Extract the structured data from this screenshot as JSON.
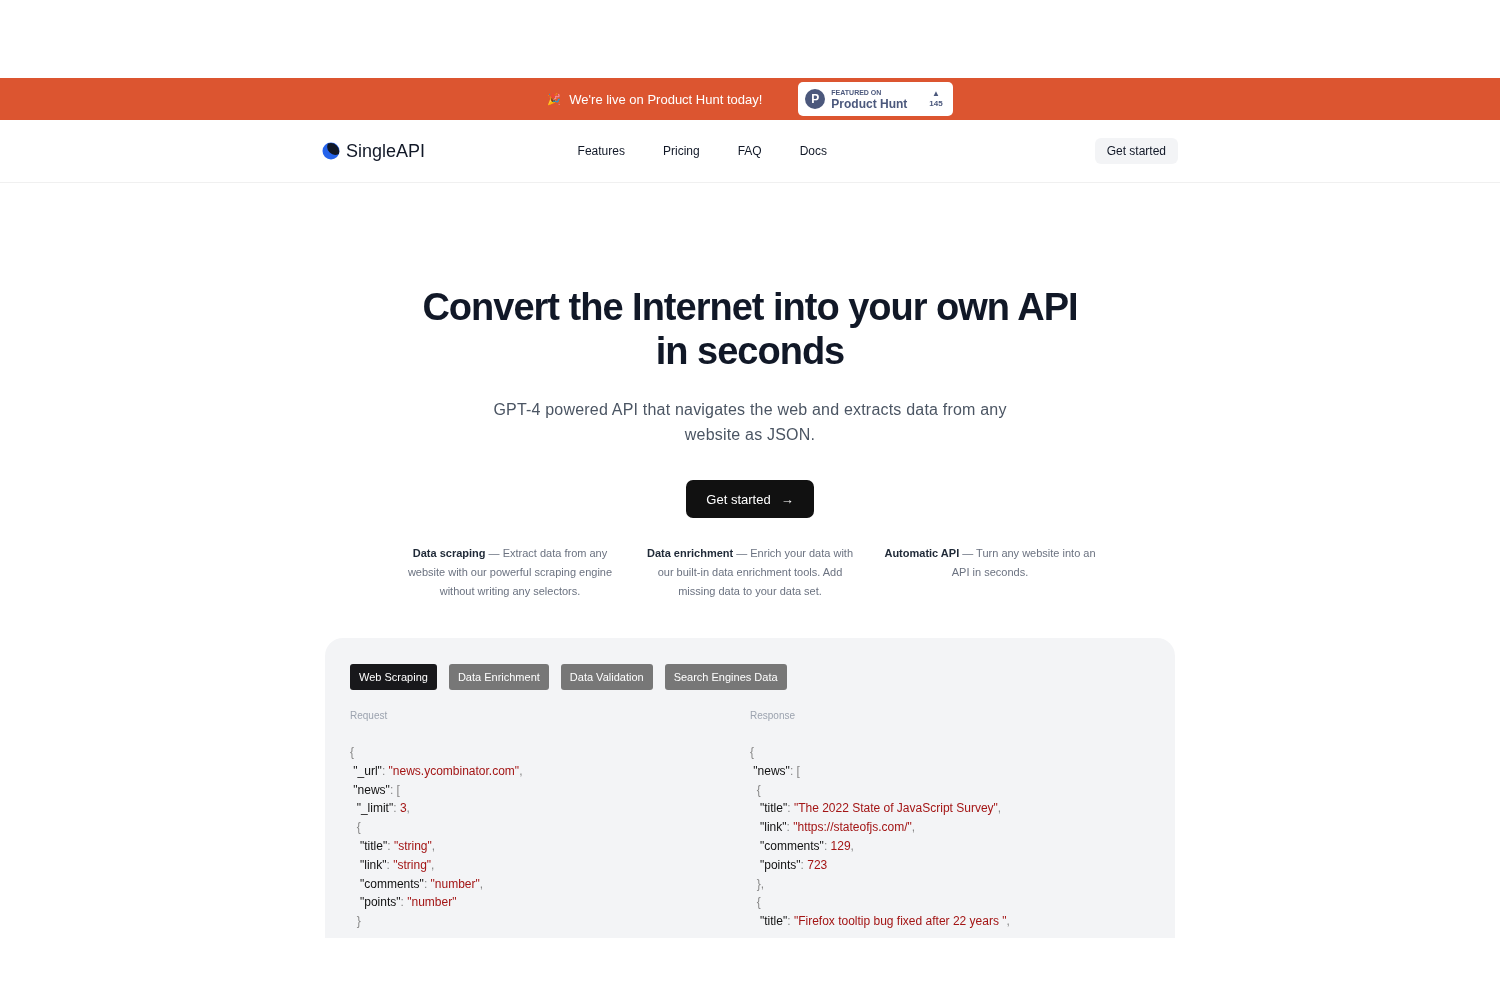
{
  "banner": {
    "emoji": "🎉",
    "text": "We're live on Product Hunt today!",
    "badge": {
      "eyebrow": "FEATURED ON",
      "name": "Product Hunt",
      "letter": "P",
      "arrow": "▲",
      "count": "145"
    }
  },
  "nav": {
    "brand": "SingleAPI",
    "links": [
      "Features",
      "Pricing",
      "FAQ",
      "Docs"
    ],
    "cta": "Get started"
  },
  "hero": {
    "title_lines": [
      "Convert the Internet into your own API",
      "in seconds"
    ],
    "subtitle": "GPT-4 powered API that navigates the web and extracts data from any website as JSON.",
    "cta": "Get started",
    "cta_arrow": "→"
  },
  "features": [
    {
      "title": "Data scraping",
      "text": " — Extract data from any website with our powerful scraping engine without writing any selectors."
    },
    {
      "title": "Data enrichment",
      "text": " — Enrich your data with our built-in data enrichment tools. Add missing data to your data set."
    },
    {
      "title": "Automatic API",
      "text": " — Turn any website into an API in seconds."
    }
  ],
  "demo": {
    "tabs": [
      {
        "label": "Web Scraping",
        "selected": true
      },
      {
        "label": "Data Enrichment",
        "selected": false
      },
      {
        "label": "Data Validation",
        "selected": false
      },
      {
        "label": "Search Engines Data",
        "selected": false
      }
    ],
    "panes": [
      {
        "label": "Request",
        "lines": [
          [
            {
              "kind": "punct",
              "text": "{"
            }
          ],
          [
            {
              "kind": "key",
              "text": " \"_url\""
            },
            {
              "kind": "punct",
              "text": ": "
            },
            {
              "kind": "value",
              "text": "\"news.ycombinator.com\""
            },
            {
              "kind": "punct",
              "text": ","
            }
          ],
          [
            {
              "kind": "key",
              "text": " \"news\""
            },
            {
              "kind": "punct",
              "text": ": ["
            }
          ],
          [
            {
              "kind": "key",
              "text": "  \"_limit\""
            },
            {
              "kind": "punct",
              "text": ": "
            },
            {
              "kind": "value",
              "text": "3"
            },
            {
              "kind": "punct",
              "text": ","
            }
          ],
          [
            {
              "kind": "punct",
              "text": "  {"
            }
          ],
          [
            {
              "kind": "key",
              "text": "   \"title\""
            },
            {
              "kind": "punct",
              "text": ": "
            },
            {
              "kind": "value",
              "text": "\"string\""
            },
            {
              "kind": "punct",
              "text": ","
            }
          ],
          [
            {
              "kind": "key",
              "text": "   \"link\""
            },
            {
              "kind": "punct",
              "text": ": "
            },
            {
              "kind": "value",
              "text": "\"string\""
            },
            {
              "kind": "punct",
              "text": ","
            }
          ],
          [
            {
              "kind": "key",
              "text": "   \"comments\""
            },
            {
              "kind": "punct",
              "text": ": "
            },
            {
              "kind": "value",
              "text": "\"number\""
            },
            {
              "kind": "punct",
              "text": ","
            }
          ],
          [
            {
              "kind": "key",
              "text": "   \"points\""
            },
            {
              "kind": "punct",
              "text": ": "
            },
            {
              "kind": "value",
              "text": "\"number\""
            }
          ],
          [
            {
              "kind": "punct",
              "text": "  }"
            }
          ]
        ]
      },
      {
        "label": "Response",
        "lines": [
          [
            {
              "kind": "punct",
              "text": "{"
            }
          ],
          [
            {
              "kind": "key",
              "text": " \"news\""
            },
            {
              "kind": "punct",
              "text": ": ["
            }
          ],
          [
            {
              "kind": "punct",
              "text": "  {"
            }
          ],
          [
            {
              "kind": "key",
              "text": "   \"title\""
            },
            {
              "kind": "punct",
              "text": ": "
            },
            {
              "kind": "value",
              "text": "\"The 2022 State of JavaScript Survey\""
            },
            {
              "kind": "punct",
              "text": ","
            }
          ],
          [
            {
              "kind": "key",
              "text": "   \"link\""
            },
            {
              "kind": "punct",
              "text": ": "
            },
            {
              "kind": "value",
              "text": "\"https://stateofjs.com/\""
            },
            {
              "kind": "punct",
              "text": ","
            }
          ],
          [
            {
              "kind": "key",
              "text": "   \"comments\""
            },
            {
              "kind": "punct",
              "text": ": "
            },
            {
              "kind": "value",
              "text": "129"
            },
            {
              "kind": "punct",
              "text": ","
            }
          ],
          [
            {
              "kind": "key",
              "text": "   \"points\""
            },
            {
              "kind": "punct",
              "text": ": "
            },
            {
              "kind": "value",
              "text": "723"
            }
          ],
          [
            {
              "kind": "punct",
              "text": "  },"
            }
          ],
          [
            {
              "kind": "punct",
              "text": "  {"
            }
          ],
          [
            {
              "kind": "key",
              "text": "   \"title\""
            },
            {
              "kind": "punct",
              "text": ": "
            },
            {
              "kind": "value",
              "text": "\"Firefox tooltip bug fixed after 22 years \""
            },
            {
              "kind": "punct",
              "text": ","
            }
          ]
        ]
      }
    ]
  }
}
